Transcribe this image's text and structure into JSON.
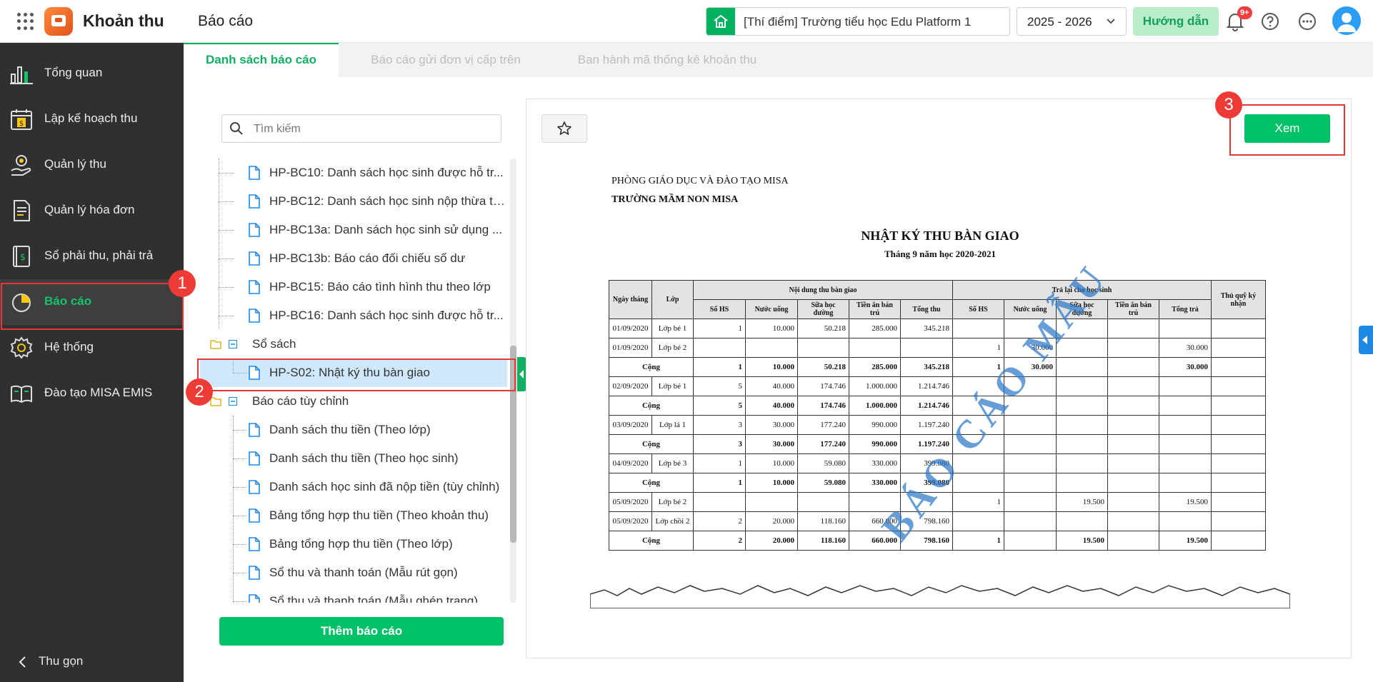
{
  "app": {
    "title": "Khoản thu",
    "page_title": "Báo cáo"
  },
  "header": {
    "school": "[Thí điểm] Trường tiểu học Edu Platform 1",
    "year": "2025 - 2026",
    "guide_label": "Hướng dẫn",
    "notification_badge": "9+"
  },
  "sidebar": {
    "items": [
      {
        "label": "Tổng quan",
        "icon": "bar-chart-icon"
      },
      {
        "label": "Lập kế hoạch thu",
        "icon": "calendar-money-icon"
      },
      {
        "label": "Quản lý thu",
        "icon": "money-hand-icon"
      },
      {
        "label": "Quản lý hóa đơn",
        "icon": "invoice-icon"
      },
      {
        "label": "Sổ phải thu, phải trả",
        "icon": "ledger-icon"
      },
      {
        "label": "Báo cáo",
        "icon": "pie-chart-icon",
        "active": true
      },
      {
        "label": "Hệ thống",
        "icon": "gear-icon"
      },
      {
        "label": "Đào tạo MISA EMIS",
        "icon": "book-icon"
      }
    ],
    "collapse_label": "Thu gọn"
  },
  "tabs": [
    {
      "label": "Danh sách báo cáo",
      "active": true
    },
    {
      "label": "Báo cáo gửi đơn vị cấp trên"
    },
    {
      "label": "Ban hành mã thống kê khoản thu"
    }
  ],
  "search": {
    "placeholder": "Tìm kiếm"
  },
  "tree": {
    "reports_top": [
      "HP-BC10: Danh sách học sinh được hỗ tr...",
      "HP-BC12: Danh sách học sinh nộp thừa ti...",
      "HP-BC13a: Danh sách học sinh sử dụng ...",
      "HP-BC13b: Báo cáo đối chiếu số dư",
      "HP-BC15: Báo cáo tình hình thu theo lớp",
      "HP-BC16: Danh sách học sinh được hỗ tr..."
    ],
    "group_sosach": "Sổ sách",
    "selected_report": "HP-S02: Nhật ký thu bàn giao",
    "group_custom": "Báo cáo tùy chỉnh",
    "reports_custom": [
      "Danh sách thu tiền (Theo lớp)",
      "Danh sách thu tiền (Theo học sinh)",
      "Danh sách học sinh đã nộp tiền (tùy chỉnh)",
      "Bảng tổng hợp thu tiền (Theo khoản thu)",
      "Bảng tổng hợp thu tiền (Theo lớp)",
      "Sổ thu và thanh toán (Mẫu rút gọn)",
      "Sổ thu và thanh toán (Mẫu ghép trang)"
    ]
  },
  "add_report_label": "Thêm báo cáo",
  "view_label": "Xem",
  "callouts": [
    "1",
    "2",
    "3"
  ],
  "report": {
    "org_line1": "PHÒNG GIÁO DỤC VÀ ĐÀO TẠO MISA",
    "org_line2": "TRƯỜNG MẦM NON MISA",
    "title": "NHẬT KÝ THU BÀN GIAO",
    "subtitle": "Tháng 9 năm học 2020-2021",
    "watermark": "BÁO CÁO MẪU",
    "headers": {
      "date": "Ngày tháng",
      "class": "Lớp",
      "group_collect": "Nội dung thu bàn giao",
      "group_return": "Trả lại cho học sinh",
      "receiver": "Thủ quỹ ký nhận",
      "cols": [
        "Số HS",
        "Nước uống",
        "Sữa học đường",
        "Tiền ăn bán trú",
        "Tổng thu",
        "Số HS",
        "Nước uống",
        "Sữa học đường",
        "Tiền ăn bán trú",
        "Tổng trả"
      ]
    },
    "rows": [
      {
        "date": "01/09/2020",
        "cls": "Lớp bé 1",
        "v": [
          "1",
          "10.000",
          "50.218",
          "285.000",
          "345.218",
          "",
          "",
          "",
          "",
          "",
          ""
        ]
      },
      {
        "date": "01/09/2020",
        "cls": "Lớp bé 2",
        "v": [
          "",
          "",
          "",
          "",
          "",
          "1",
          "30.000",
          "",
          "",
          "30.000",
          ""
        ]
      },
      {
        "sum": true,
        "label": "Cộng",
        "v": [
          "1",
          "10.000",
          "50.218",
          "285.000",
          "345.218",
          "1",
          "30.000",
          "",
          "",
          "30.000",
          ""
        ]
      },
      {
        "date": "02/09/2020",
        "cls": "Lớp bé 1",
        "v": [
          "5",
          "40.000",
          "174.746",
          "1.000.000",
          "1.214.746",
          "",
          "",
          "",
          "",
          "",
          ""
        ]
      },
      {
        "sum": true,
        "label": "Cộng",
        "v": [
          "5",
          "40.000",
          "174.746",
          "1.000.000",
          "1.214.746",
          "",
          "",
          "",
          "",
          "",
          ""
        ]
      },
      {
        "date": "03/09/2020",
        "cls": "Lớp lá 1",
        "v": [
          "3",
          "30.000",
          "177.240",
          "990.000",
          "1.197.240",
          "",
          "",
          "",
          "",
          "",
          ""
        ]
      },
      {
        "sum": true,
        "label": "Cộng",
        "v": [
          "3",
          "30.000",
          "177.240",
          "990.000",
          "1.197.240",
          "",
          "",
          "",
          "",
          "",
          ""
        ]
      },
      {
        "date": "04/09/2020",
        "cls": "Lớp bé 3",
        "v": [
          "1",
          "10.000",
          "59.080",
          "330.000",
          "399.080",
          "",
          "",
          "",
          "",
          "",
          ""
        ]
      },
      {
        "sum": true,
        "label": "Cộng",
        "v": [
          "1",
          "10.000",
          "59.080",
          "330.000",
          "399.080",
          "",
          "",
          "",
          "",
          "",
          ""
        ]
      },
      {
        "date": "05/09/2020",
        "cls": "Lớp bé 2",
        "v": [
          "",
          "",
          "",
          "",
          "",
          "1",
          "",
          "19.500",
          "",
          "19.500",
          ""
        ]
      },
      {
        "date": "05/09/2020",
        "cls": "Lớp chồi 2",
        "v": [
          "2",
          "20.000",
          "118.160",
          "660.000",
          "798.160",
          "",
          "",
          "",
          "",
          "",
          ""
        ]
      },
      {
        "sum": true,
        "label": "Cộng",
        "v": [
          "2",
          "20.000",
          "118.160",
          "660.000",
          "798.160",
          "1",
          "",
          "19.500",
          "",
          "19.500",
          ""
        ]
      }
    ]
  },
  "colors": {
    "accent": "#00c068",
    "sidebar_bg": "#303030",
    "callout": "#ef3b36"
  }
}
